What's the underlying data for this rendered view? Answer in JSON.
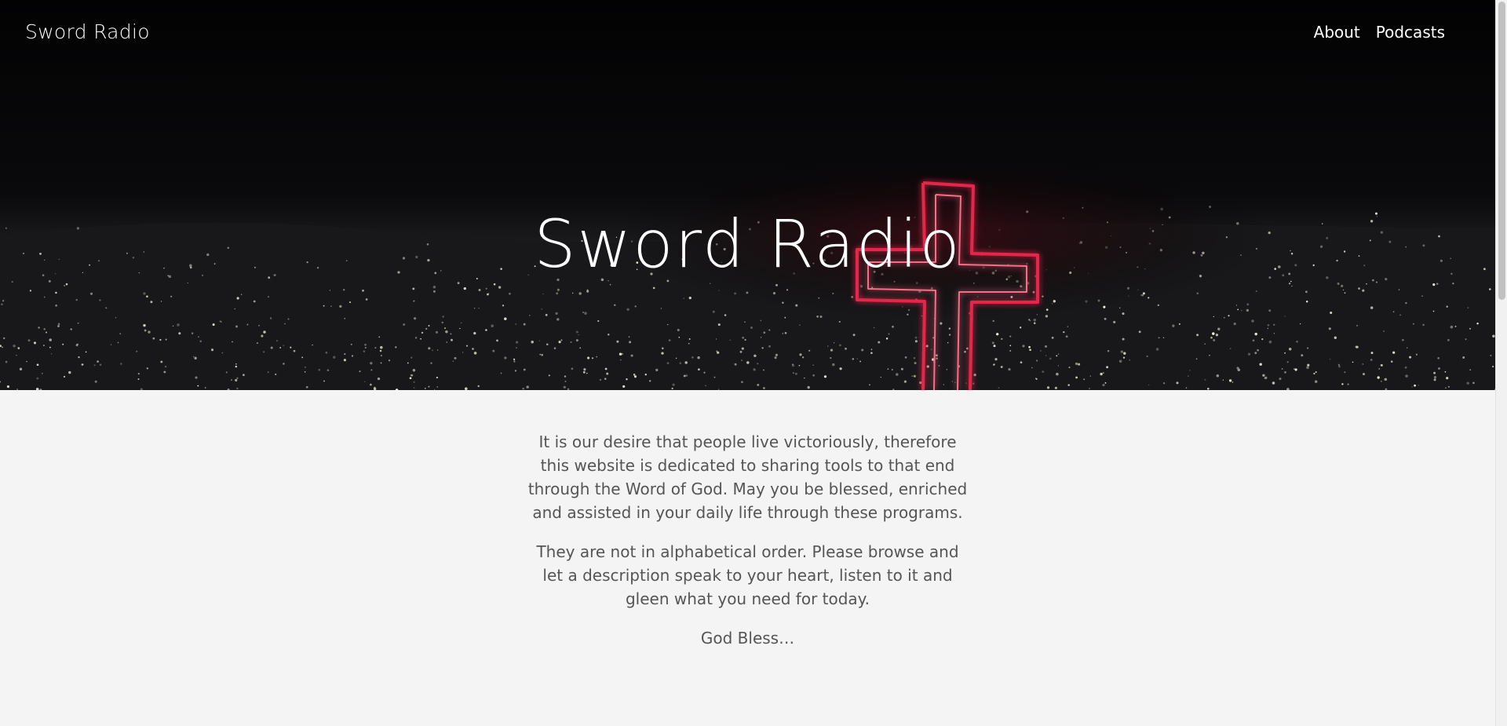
{
  "header": {
    "site_title": "Sword Radio",
    "nav": [
      {
        "label": "About"
      },
      {
        "label": "Podcasts"
      }
    ]
  },
  "hero": {
    "heading": "Sword Radio",
    "accent_color": "#d4143a"
  },
  "content": {
    "paragraphs": [
      "It is our desire that people live victoriously, therefore this website is dedicated to sharing tools to that end through the Word of God. May you be blessed, enriched and assisted in your daily life through these programs.",
      "They are not in alphabetical order. Please browse and let a description speak to your heart, listen to it and gleen what you need for today.",
      "God Bless…"
    ]
  }
}
